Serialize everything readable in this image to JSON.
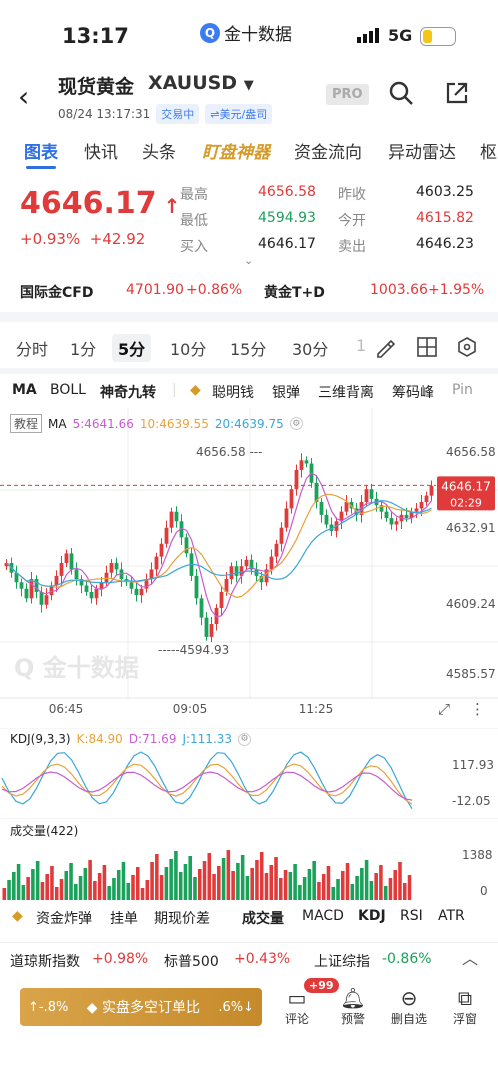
{
  "status_bar": {
    "time": "13:17",
    "app_name": "金十数据",
    "network": "5G"
  },
  "header": {
    "title": "现货黄金",
    "symbol": "XAUUSD",
    "datetime": "08/24 13:17:31",
    "trade_status": "交易中",
    "unit": "⇌美元/盎司",
    "pro": "PRO"
  },
  "tabs": [
    "图表",
    "快讯",
    "头条",
    "盯盘神器",
    "资金流向",
    "异动雷达",
    "枢"
  ],
  "price": {
    "last": "4646.17",
    "pct": "+0.93%",
    "change": "+42.92",
    "high_label": "最高",
    "high": "4656.58",
    "low_label": "最低",
    "low": "4594.93",
    "bid_label": "买入",
    "bid": "4646.17",
    "prev_label": "昨收",
    "prev": "4603.25",
    "open_label": "今开",
    "open": "4615.82",
    "ask_label": "卖出",
    "ask": "4646.23"
  },
  "ticker": [
    {
      "name": "国际金CFD",
      "value": "4701.90",
      "pct": "+0.86%"
    },
    {
      "name": "黄金T+D",
      "value": "1003.66",
      "pct": "+1.95%"
    }
  ],
  "periods": [
    "分时",
    "1分",
    "5分",
    "10分",
    "15分",
    "30分",
    "1"
  ],
  "indicators": [
    "MA",
    "BOLL",
    "神奇九转",
    "聪明钱",
    "银弹",
    "三维背离",
    "筹码峰",
    "Pin"
  ],
  "chart_labels": {
    "tutorial": "教程",
    "ma_prefix": "MA",
    "ma5": "5:4641.66",
    "ma10": "10:4639.55",
    "ma20": "20:4639.75",
    "high_mark": "4656.58",
    "low_mark": "4594.93",
    "axis_right": [
      "4656.58",
      "4632.91",
      "4609.24",
      "4585.57"
    ],
    "current_price": "4646.17",
    "countdown": "02:29",
    "times": [
      "06:45",
      "09:05",
      "11:25"
    ],
    "watermark": "金十数据"
  },
  "kdj": {
    "title": "KDJ(9,3,3)",
    "k": "K:84.90",
    "d": "D:71.69",
    "j": "J:111.33",
    "top": "117.93",
    "bottom": "-12.05"
  },
  "volume": {
    "title": "成交量(422)",
    "top": "1388",
    "bottom": "0"
  },
  "bottom_tabs": [
    "资金炸弹",
    "挂单",
    "期现价差",
    "成交量",
    "MACD",
    "KDJ",
    "RSI",
    "ATR"
  ],
  "indices": [
    {
      "name": "道琼斯指数",
      "pct": "+0.98%"
    },
    {
      "name": "标普500",
      "pct": "+0.43%"
    },
    {
      "name": "上证综指",
      "pct": "-0.86%"
    }
  ],
  "actions": {
    "order_ratio": "实盘多空订单比",
    "left_pct": "↑-.8%",
    "right_pct": ".6%↓",
    "comment": "评论",
    "comment_badge": "+99",
    "alert": "预警",
    "remove_watch": "删自选",
    "float": "浮窗"
  },
  "chart_data": {
    "type": "candlestick",
    "y_axis": {
      "min": 4585.57,
      "max": 4656.58
    },
    "x_ticks": [
      "06:45",
      "09:05",
      "11:25"
    ],
    "ohlc_close": [
      4622,
      4619,
      4616,
      4614,
      4611,
      4617,
      4613,
      4609,
      4612,
      4615,
      4618,
      4622,
      4625,
      4620,
      4617,
      4615,
      4613,
      4611,
      4614,
      4616,
      4619,
      4622,
      4620,
      4617,
      4616,
      4614,
      4612,
      4614,
      4617,
      4620,
      4624,
      4628,
      4633,
      4638,
      4635,
      4630,
      4625,
      4618,
      4611,
      4605,
      4599,
      4603,
      4608,
      4613,
      4617,
      4621,
      4618,
      4621,
      4623,
      4620,
      4618,
      4616,
      4620,
      4624,
      4628,
      4633,
      4639,
      4645,
      4651,
      4654,
      4653,
      4647,
      4641,
      4637,
      4634,
      4632,
      4635,
      4638,
      4641,
      4639,
      4637,
      4641,
      4645,
      4642,
      4640,
      4638,
      4636,
      4634,
      4635,
      4637,
      4636,
      4638,
      4639,
      4641,
      4643,
      4646
    ],
    "ma5": "4641.66",
    "ma10": "4639.55",
    "ma20": "4639.75"
  }
}
